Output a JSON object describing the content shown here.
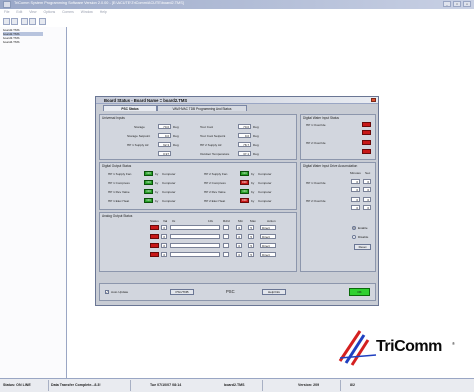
{
  "window": {
    "title": "TriComm System Programming Software  Version 2.0.00  -  [E:\\ACUTE\\TriComm\\ACUTE\\board2.TMS]",
    "buttons": [
      "_",
      "□",
      "x"
    ]
  },
  "menu": [
    "File",
    "Edit",
    "View",
    "Options",
    "Comms",
    "Window",
    "Help"
  ],
  "left_panel": {
    "items": [
      "board2.TMS",
      "board2.TMS",
      "board3.TMS",
      "board4.TMS"
    ],
    "selected_index": 1
  },
  "dialog": {
    "title": "Board Status  -  Board Name = board2.TMS",
    "tabs": [
      "PSC Status",
      "VAV/HVAC TDB Programming And Status"
    ],
    "active_tab": 0,
    "universal_inputs": {
      "title": "Universal Inputs",
      "rows": [
        {
          "label": "Storage",
          "value": "70.0",
          "unit": "Deg",
          "label2": "Tout Cool",
          "value2": "70.0",
          "unit2": "Deg"
        },
        {
          "label": "Storage Setpoint",
          "value": "0.0",
          "unit": "Deg",
          "label2": "Tout Cool Setpoint",
          "value2": "0.0",
          "unit2": "Deg"
        },
        {
          "label": "HP 1 Supply Air",
          "value": "92.3",
          "unit": "Deg",
          "label2": "HP 2 Supply Air",
          "value2": "78.7",
          "unit2": "Deg"
        },
        {
          "label": "",
          "value": "0.97",
          "unit": "",
          "label2": "Outdoor Temperature",
          "value2": "37.1",
          "unit2": "Deg"
        }
      ]
    },
    "digital_output": {
      "title": "Digital Output Status",
      "rows": [
        {
          "label": "HP 1 Supply Fan",
          "state": "ON",
          "by": "Computer",
          "label2": "HP 2 Supply Fan",
          "state2": "ON",
          "by2": "Computer"
        },
        {
          "label": "HP 1 Compress",
          "state": "ON",
          "by": "Computer",
          "label2": "HP 2 Compress",
          "state2": "OFF",
          "by2": "Computer"
        },
        {
          "label": "HP 1 Rev Valve",
          "state": "ON",
          "by": "Computer",
          "label2": "HP 2 Rev Valve",
          "state2": "ON",
          "by2": "Computer"
        },
        {
          "label": "HP 1 Elec Heat",
          "state": "ON",
          "by": "Computer",
          "label2": "HP 2 Elec Heat",
          "state2": "OFF",
          "by2": "Computer"
        }
      ],
      "by_prefix": "by"
    },
    "analog_output": {
      "title": "Analog Output Status",
      "headers": [
        "Status",
        "Val",
        "0x",
        "",
        "10x",
        "Rd/d",
        "Min",
        "Max",
        "Action"
      ],
      "rows": [
        {
          "val": "0",
          "min": "0",
          "max": "5",
          "action": "Direct"
        },
        {
          "val": "0",
          "min": "0",
          "max": "5",
          "action": "Direct"
        },
        {
          "val": "0",
          "min": "0",
          "max": "5",
          "action": "Direct"
        },
        {
          "val": "0",
          "min": "0",
          "max": "5",
          "action": "Direct"
        }
      ]
    },
    "digital_input": {
      "title": "Digital Water Input Status",
      "rows": [
        {
          "label": "HP 1 Override"
        },
        {
          "label": ""
        },
        {
          "label": "HP 2 Override"
        },
        {
          "label": ""
        }
      ]
    },
    "accumulation": {
      "title": "Digital Water Input Drive Accumulation",
      "headers": [
        "Minutes",
        "Sec"
      ],
      "rows": [
        {
          "label": "HP 1 Override",
          "min": "0",
          "sec": "0"
        },
        {
          "label": "",
          "min": "0",
          "sec": "0"
        },
        {
          "label": "HP 2 Override",
          "min": "0",
          "sec": "0"
        },
        {
          "label": "",
          "min": "0",
          "sec": "0"
        }
      ]
    },
    "enable_group": {
      "options": [
        "Enable",
        "Disable"
      ],
      "selected": 0,
      "reset_label": "Reset"
    },
    "footer": {
      "auto_update_label": "Auto Update",
      "psc_button": "PSC/TDB",
      "psc_label": "PSC",
      "help_button": "Help/Info",
      "ok_button": "OK"
    }
  },
  "logo": {
    "brand": "TriComm",
    "trademark": "®",
    "colors": {
      "red": "#d42020",
      "blue": "#2040c0"
    }
  },
  "statusbar": {
    "status": "Status: ON LINE",
    "transfer": "Data Transfer Complete...8.3!",
    "datetime": "Tue  07/10/07  08:14",
    "board": "board2.TMS",
    "version": "Version: 209",
    "extra": "8/2"
  }
}
